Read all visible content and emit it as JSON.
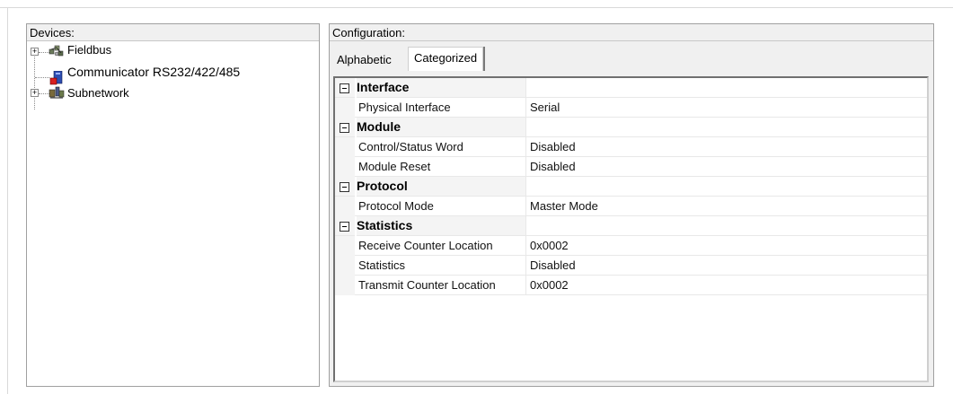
{
  "devices": {
    "header": "Devices:",
    "items": [
      {
        "label": "Fieldbus",
        "expandable": true,
        "expander": "+"
      },
      {
        "label": "Communicator RS232/422/485",
        "expandable": false
      },
      {
        "label": "Subnetwork",
        "expandable": true,
        "expander": "+"
      }
    ]
  },
  "configuration": {
    "header": "Configuration:",
    "tabs": [
      {
        "label": "Alphabetic",
        "selected": false
      },
      {
        "label": "Categorized",
        "selected": true
      }
    ],
    "categories": [
      {
        "name": "Interface",
        "properties": [
          {
            "name": "Physical Interface",
            "value": "Serial"
          }
        ]
      },
      {
        "name": "Module",
        "properties": [
          {
            "name": "Control/Status Word",
            "value": "Disabled"
          },
          {
            "name": "Module Reset",
            "value": "Disabled"
          }
        ]
      },
      {
        "name": "Protocol",
        "properties": [
          {
            "name": "Protocol Mode",
            "value": "Master Mode"
          }
        ]
      },
      {
        "name": "Statistics",
        "properties": [
          {
            "name": "Receive Counter Location",
            "value": "0x0002"
          },
          {
            "name": "Statistics",
            "value": "Disabled"
          },
          {
            "name": "Transmit Counter Location",
            "value": "0x0002"
          }
        ]
      }
    ]
  },
  "icons": {
    "fieldbus": "fieldbus-network-icon",
    "communicator": "communicator-device-icon",
    "subnetwork": "subnetwork-icon",
    "collapse": "collapse-minus-icon",
    "expand": "expand-plus-icon"
  }
}
